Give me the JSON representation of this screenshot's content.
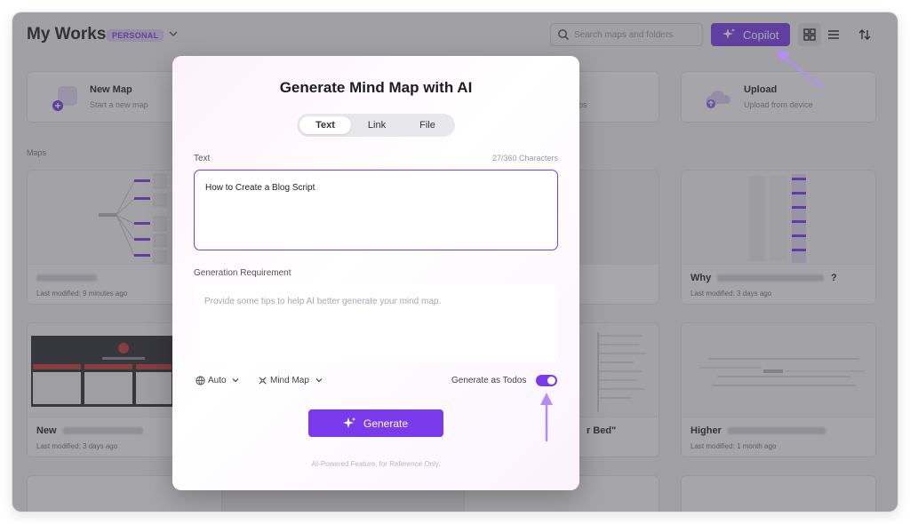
{
  "header": {
    "title": "My Works",
    "badge": "PERSONAL",
    "search_placeholder": "Search maps and folders",
    "copilot_label": "Copilot",
    "icons": [
      "chevron-down-icon",
      "search-icon",
      "sparkle-icon",
      "grid-view-icon",
      "list-view-icon",
      "sort-icon"
    ]
  },
  "quick_actions": [
    {
      "title": "New Map",
      "subtitle": "Start a new map"
    },
    {
      "title": "Upload",
      "subtitle": "Upload from device"
    }
  ],
  "partial_text": {
    "qa_fragment": "ps",
    "card_fragment_q": "?",
    "card_fragment_bed": "r Bed\""
  },
  "maps_section_label": "Maps",
  "maps": [
    {
      "name": "",
      "modified": "Last modified: 9 minutes ago"
    },
    {
      "name": "Why",
      "modified": "Last modified: 3 days ago"
    },
    {
      "name": "New",
      "modified": "Last modified: 3 days ago"
    },
    {
      "name": "Higher",
      "modified": "Last modified: 1 month ago"
    }
  ],
  "modal": {
    "title": "Generate Mind Map with AI",
    "tabs": [
      "Text",
      "Link",
      "File"
    ],
    "active_tab": "Text",
    "text_label": "Text",
    "char_count": "27/360 Characters",
    "text_value": "How to Create a Blog Script",
    "requirement_label": "Generation Requirement",
    "requirement_placeholder": "Provide some tips to help AI better generate your mind map.",
    "language_option": "Auto",
    "map_type_option": "Mind Map",
    "todos_label": "Generate as Todos",
    "todos_enabled": true,
    "generate_label": "Generate",
    "footnote": "AI-Powered Feature, for Reference Only."
  },
  "colors": {
    "accent": "#7c3aed",
    "badge_bg": "#e2d4fb",
    "arrow": "#b48cf5"
  }
}
